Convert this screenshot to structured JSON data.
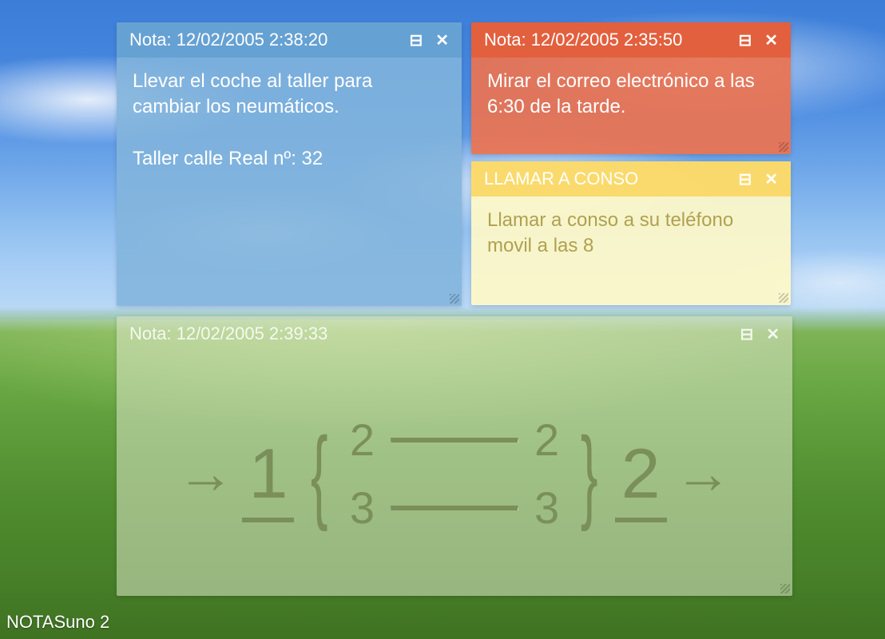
{
  "app": {
    "label": "NOTASuno 2"
  },
  "notes": {
    "blue": {
      "title": "Nota: 12/02/2005 2:38:20",
      "body_line1": "Llevar el coche al taller para cambiar los neumáticos.",
      "body_line2": "Taller calle Real nº: 32"
    },
    "red": {
      "title": "Nota: 12/02/2005 2:35:50",
      "body": "Mirar el correo electrónico a las 6:30 de la tarde."
    },
    "yellow": {
      "title": "LLAMAR A CONSO",
      "body": "Llamar a conso a su teléfono movil a las 8"
    },
    "green": {
      "title": "Nota: 12/02/2005 2:39:33",
      "arrow": "→",
      "n1": "1",
      "pair_a": "2",
      "pair_b": "3",
      "pair_a2": "2",
      "pair_b2": "3",
      "n2": "2"
    }
  },
  "icons": {
    "minimize": "⊟",
    "close": "✕",
    "brace_open": "{",
    "brace_close": "}"
  }
}
